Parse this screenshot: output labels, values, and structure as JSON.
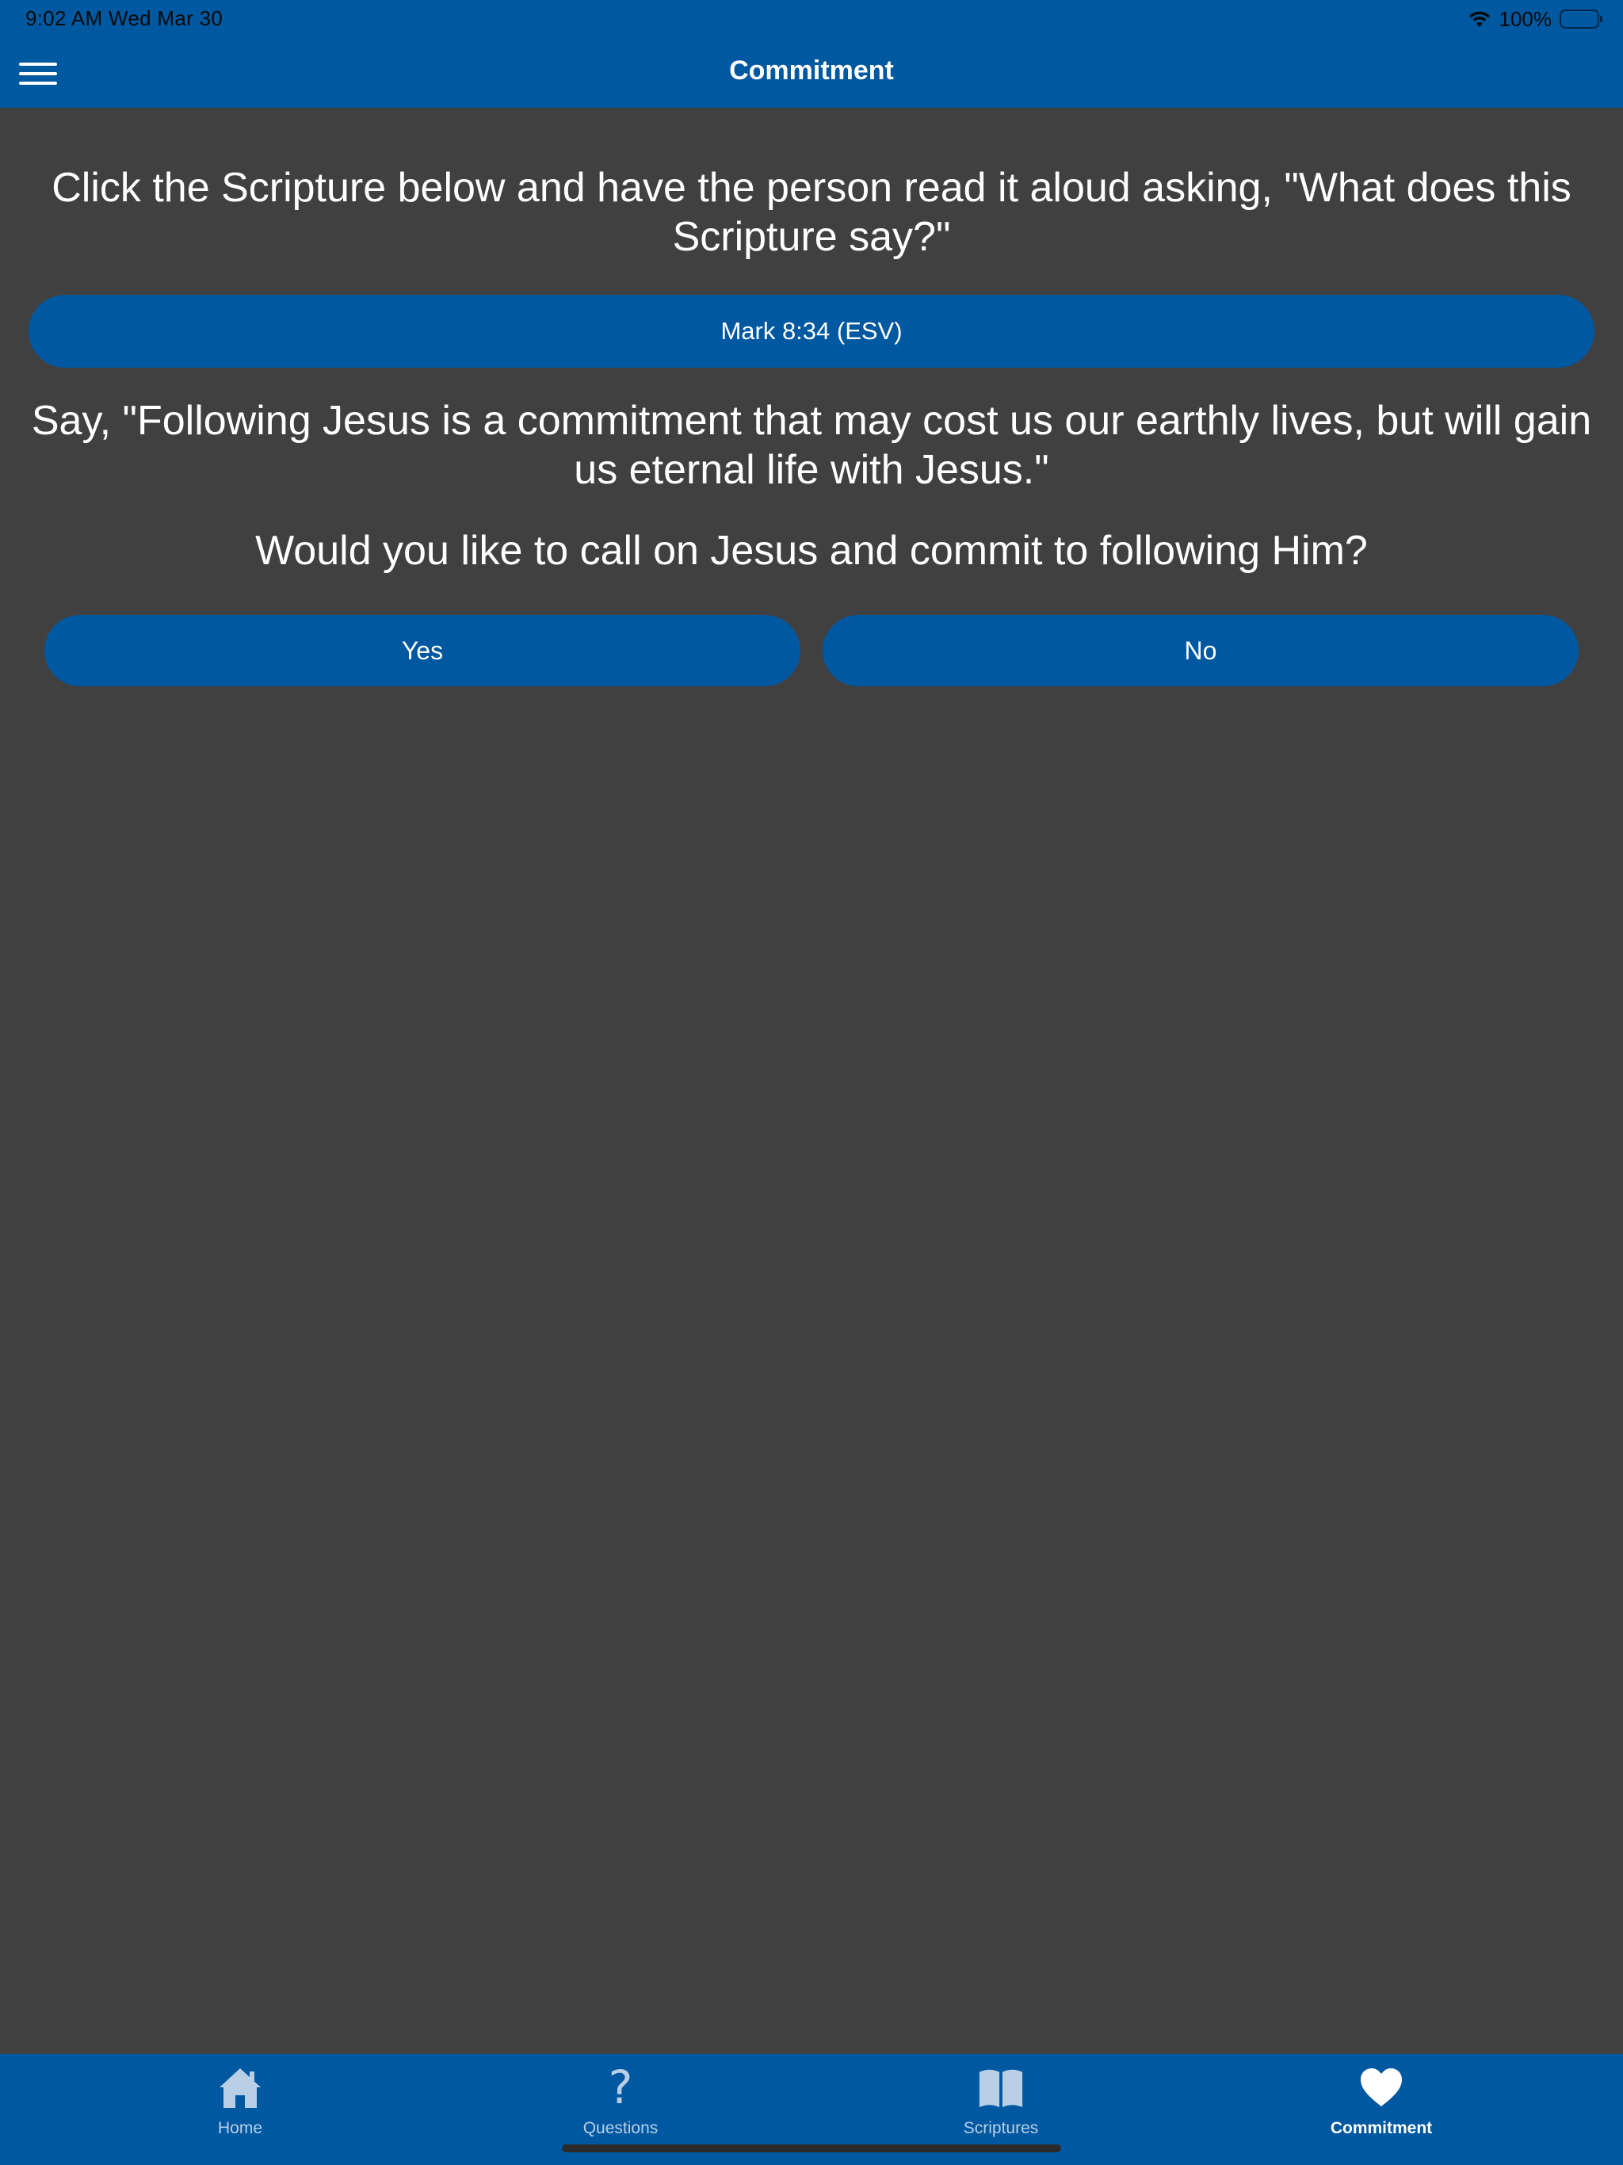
{
  "status_bar": {
    "time": "9:02 AM   Wed Mar 30",
    "battery": "100%"
  },
  "nav": {
    "title": "Commitment",
    "menu_icon": "hamburger-menu-icon"
  },
  "main": {
    "instruction": "Click the Scripture below and have the person read it aloud asking, \"What does this Scripture say?\"",
    "scripture_button": "Mark 8:34 (ESV)",
    "statement": "Say, \"Following Jesus is a commitment that may cost us our earthly lives, but will gain us eternal life with Jesus.\"",
    "question": "Would you like to call on Jesus and commit to following Him?",
    "yes_label": "Yes",
    "no_label": "No"
  },
  "tabs": [
    {
      "label": "Home",
      "icon": "house-icon",
      "active": false
    },
    {
      "label": "Questions",
      "icon": "question-mark-icon",
      "active": false
    },
    {
      "label": "Scriptures",
      "icon": "open-book-icon",
      "active": false
    },
    {
      "label": "Commitment",
      "icon": "heart-icon",
      "active": true
    }
  ],
  "colors": {
    "primary": "#0058a1",
    "background": "#404040",
    "text": "#ffffff",
    "tab_inactive": "#b9cfe6"
  }
}
